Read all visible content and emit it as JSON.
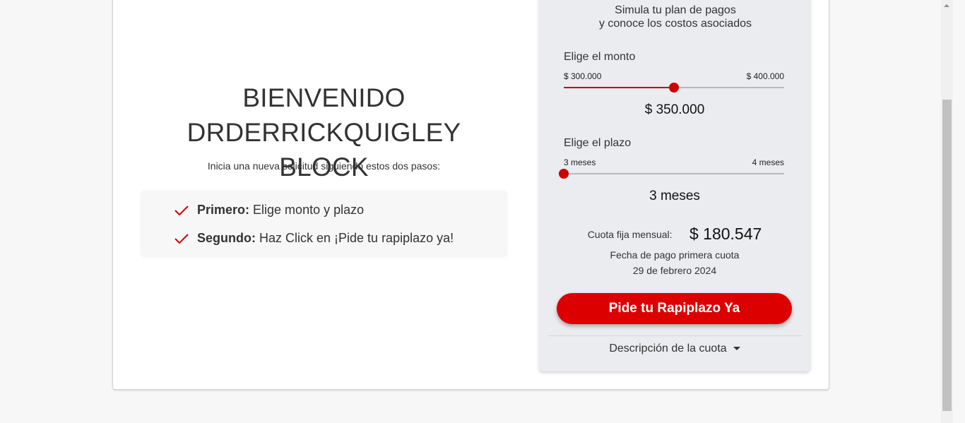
{
  "welcome": {
    "line1": "BIENVENIDO",
    "line2": "DRDERRICKQUIGLEY BLOCK",
    "subtitle": "Inicia una nueva solicitud siguiendo estos dos pasos:"
  },
  "steps": [
    {
      "bold": "Primero:",
      "text": "Elige monto y plazo",
      "icon": "check-icon"
    },
    {
      "bold": "Segundo:",
      "text": "Haz Click en ¡Pide tu rapiplazo ya!",
      "icon": "check-icon"
    }
  ],
  "simulator": {
    "heading_line1": "Simula tu plan de pagos",
    "heading_line2": "y conoce los costos asociados",
    "amount": {
      "label": "Elige el monto",
      "min": "$ 300.000",
      "max": "$ 400.000",
      "value": "$ 350.000",
      "fraction": 0.5
    },
    "term": {
      "label": "Elige el plazo",
      "min": "3 meses",
      "max": "4 meses",
      "value": "3 meses",
      "fraction": 0
    },
    "cuota_label": "Cuota fija mensual:",
    "cuota_value": "$ 180.547",
    "fecha_label": "Fecha de pago primera cuota",
    "fecha_value": "29 de febrero 2024",
    "cta_label": "Pide tu Rapiplazo Ya",
    "desc_label": "Descripción de la cuota",
    "desc_icon": "caret-down-icon"
  },
  "colors": {
    "accent": "#dd0000",
    "slider": "#cc0000",
    "panel_bg": "#ebecf0"
  }
}
